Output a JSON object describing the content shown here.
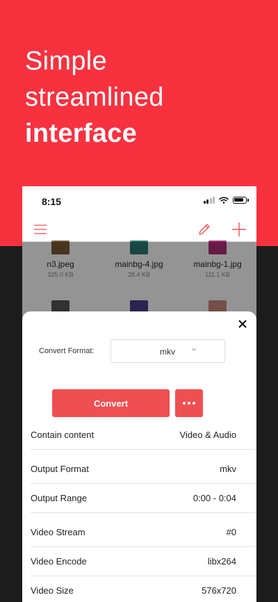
{
  "hero": {
    "line1": "Simple",
    "line2": "streamlined",
    "line3": "interface"
  },
  "colors": {
    "brand_red": "#f8313f",
    "button_red": "#ef4f52",
    "dark_bg": "#1c1c1c"
  },
  "status_bar": {
    "time": "8:15",
    "icons": [
      "signal-icon",
      "wifi-icon",
      "battery-icon"
    ]
  },
  "navbar": {
    "icons": [
      "menu-icon",
      "pencil-icon",
      "plus-icon"
    ]
  },
  "files": [
    {
      "name": "n3.jpeg",
      "size": "325.0 KB",
      "color": "#7a5a3a"
    },
    {
      "name": "mainbg-4.jpg",
      "size": "28.4 KB",
      "color": "#2a7a72"
    },
    {
      "name": "mainbg-1.jpg",
      "size": "111.1 KB",
      "color": "#b0307a"
    },
    {
      "name": "",
      "size": "",
      "color": "#555555"
    },
    {
      "name": "",
      "size": "",
      "color": "#4a3f8a"
    },
    {
      "name": "",
      "size": "",
      "color": "#c8877a"
    }
  ],
  "sheet": {
    "convert_format_label": "Convert Format:",
    "format_value": "mkv",
    "convert_label": "Convert",
    "rows": [
      {
        "key": "Contain content",
        "value": "Video & Audio"
      },
      {
        "key": "Output Format",
        "value": "mkv"
      },
      {
        "key": "Output Range",
        "value": "0:00 - 0:04"
      },
      {
        "key": "Video Stream",
        "value": "#0"
      },
      {
        "key": "Video Encode",
        "value": "libx264"
      },
      {
        "key": "Video Size",
        "value": "576x720"
      }
    ]
  }
}
